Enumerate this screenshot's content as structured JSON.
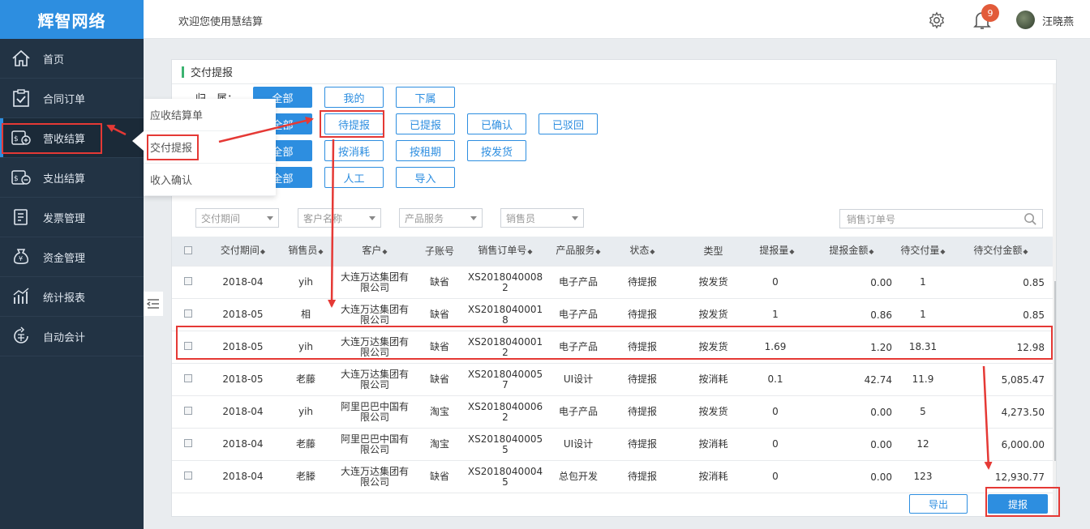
{
  "app": {
    "logo": "辉智网络"
  },
  "sidebar": {
    "items": [
      {
        "label": "首页",
        "icon": "home-icon"
      },
      {
        "label": "合同订单",
        "icon": "clipboard-check-icon"
      },
      {
        "label": "营收结算",
        "icon": "revenue-icon"
      },
      {
        "label": "支出结算",
        "icon": "expense-icon"
      },
      {
        "label": "发票管理",
        "icon": "invoice-icon"
      },
      {
        "label": "资金管理",
        "icon": "money-bag-icon"
      },
      {
        "label": "统计报表",
        "icon": "chart-icon"
      },
      {
        "label": "自动会计",
        "icon": "auto-accounting-icon"
      }
    ]
  },
  "submenu": {
    "items": [
      "应收结算单",
      "交付提报",
      "收入确认"
    ]
  },
  "header": {
    "welcome": "欢迎您使用慧结算",
    "notification_count": "9",
    "username": "汪晓燕"
  },
  "panel": {
    "title": "交付提报",
    "ownership_label": "归　属：",
    "filter_rows": [
      [
        "全部",
        "我的",
        "下属"
      ],
      [
        "全部",
        "待提报",
        "已提报",
        "已确认",
        "已驳回"
      ],
      [
        "全部",
        "按消耗",
        "按租期",
        "按发货"
      ],
      [
        "全部",
        "人工",
        "导入"
      ]
    ],
    "dropdowns": [
      "交付期间",
      "客户名称",
      "产品服务",
      "销售员"
    ],
    "search_placeholder": "销售订单号",
    "export_label": "导出",
    "submit_label": "提报"
  },
  "table": {
    "headers": [
      "交付期间",
      "销售员",
      "客户",
      "子账号",
      "销售订单号",
      "产品服务",
      "状态",
      "类型",
      "提报量",
      "提报金额",
      "待交付量",
      "待交付金额"
    ],
    "rows": [
      {
        "period": "2018-04",
        "sales": "yih",
        "cust1": "大连万达集团有",
        "cust2": "限公司",
        "sub": "缺省",
        "ord1": "XS2018040008",
        "ord2": "2",
        "prod": "电子产品",
        "status": "待提报",
        "type": "按发货",
        "qty": "0",
        "amt": "0.00",
        "pqty": "1",
        "pamt": "0.85"
      },
      {
        "period": "2018-05",
        "sales": "相",
        "cust1": "大连万达集团有",
        "cust2": "限公司",
        "sub": "缺省",
        "ord1": "XS2018040001",
        "ord2": "8",
        "prod": "电子产品",
        "status": "待提报",
        "type": "按发货",
        "qty": "1",
        "amt": "0.86",
        "pqty": "1",
        "pamt": "0.85"
      },
      {
        "period": "2018-05",
        "sales": "yih",
        "cust1": "大连万达集团有",
        "cust2": "限公司",
        "sub": "缺省",
        "ord1": "XS2018040001",
        "ord2": "2",
        "prod": "电子产品",
        "status": "待提报",
        "type": "按发货",
        "qty": "1.69",
        "amt": "1.20",
        "pqty": "18.31",
        "pamt": "12.98"
      },
      {
        "period": "2018-05",
        "sales": "老藤",
        "cust1": "大连万达集团有",
        "cust2": "限公司",
        "sub": "缺省",
        "ord1": "XS2018040005",
        "ord2": "7",
        "prod": "UI设计",
        "status": "待提报",
        "type": "按消耗",
        "qty": "0.1",
        "amt": "42.74",
        "pqty": "11.9",
        "pamt": "5,085.47"
      },
      {
        "period": "2018-04",
        "sales": "yih",
        "cust1": "阿里巴巴中国有",
        "cust2": "限公司",
        "sub": "淘宝",
        "ord1": "XS2018040006",
        "ord2": "2",
        "prod": "电子产品",
        "status": "待提报",
        "type": "按发货",
        "qty": "0",
        "amt": "0.00",
        "pqty": "5",
        "pamt": "4,273.50"
      },
      {
        "period": "2018-04",
        "sales": "老藤",
        "cust1": "阿里巴巴中国有",
        "cust2": "限公司",
        "sub": "淘宝",
        "ord1": "XS2018040005",
        "ord2": "5",
        "prod": "UI设计",
        "status": "待提报",
        "type": "按消耗",
        "qty": "0",
        "amt": "0.00",
        "pqty": "12",
        "pamt": "6,000.00"
      },
      {
        "period": "2018-04",
        "sales": "老滕",
        "cust1": "大连万达集团有",
        "cust2": "限公司",
        "sub": "缺省",
        "ord1": "XS2018040004",
        "ord2": "5",
        "prod": "总包开发",
        "status": "待提报",
        "type": "按消耗",
        "qty": "0",
        "amt": "0.00",
        "pqty": "123",
        "pamt": "12,930.77"
      }
    ]
  },
  "colors": {
    "primary": "#2d8ee0",
    "sidebar": "#223344",
    "annotation": "#e53935"
  }
}
